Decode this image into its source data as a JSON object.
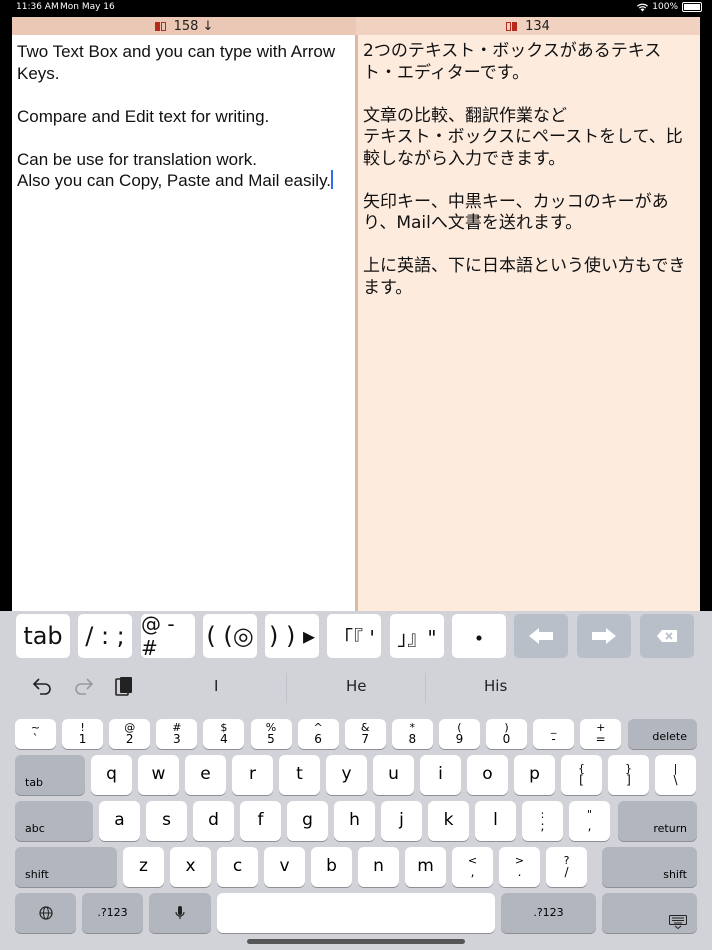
{
  "status": {
    "time": "11:36 AM",
    "date": "Mon May 16",
    "battery": "100%"
  },
  "left_pane": {
    "count": "158 ↓",
    "text": "Two Text Box and you can type with Arrow Keys.\n\nCompare and Edit text for writing.\n\nCan be use for translation work.\nAlso you can Copy, Paste and Mail easily."
  },
  "right_pane": {
    "count": "134",
    "text": "2つのテキスト・ボックスがあるテキスト・エディターです。\n\n文章の比較、翻訳作業など\nテキスト・ボックスにペーストをして、比較しながら入力できます。\n\n矢印キー、中黒キー、カッコのキーがあり、Mailへ文書を送れます。\n\n上に英語、下に日本語という使い方もできます。"
  },
  "accessory": {
    "tab": "tab",
    "slash": "/ : ;",
    "at": "@ - #",
    "open_paren": "( (◎",
    "close_paren": ") ) ▸",
    "open_bracket": "「『 '",
    "close_bracket": "」』\"",
    "dot": "・",
    "left_icon": "arrow-left-icon",
    "right_icon": "arrow-right-icon",
    "delete_icon": "delete-icon"
  },
  "suggestions": [
    "I",
    "He",
    "His"
  ],
  "keyboard": {
    "number_row": [
      [
        "~",
        "`"
      ],
      [
        "!",
        "1"
      ],
      [
        "@",
        "2"
      ],
      [
        "#",
        "3"
      ],
      [
        "$",
        "4"
      ],
      [
        "%",
        "5"
      ],
      [
        "^",
        "6"
      ],
      [
        "&",
        "7"
      ],
      [
        "*",
        "8"
      ],
      [
        "(",
        "9"
      ],
      [
        ")",
        "0"
      ],
      [
        "_",
        "-"
      ],
      [
        "+",
        "="
      ]
    ],
    "row1": [
      "q",
      "w",
      "e",
      "r",
      "t",
      "y",
      "u",
      "i",
      "o",
      "p"
    ],
    "row1_sym": [
      [
        "{",
        "["
      ],
      [
        "}",
        "]"
      ],
      [
        "|",
        "\\"
      ]
    ],
    "row2": [
      "a",
      "s",
      "d",
      "f",
      "g",
      "h",
      "j",
      "k",
      "l"
    ],
    "row2_sym": [
      [
        ":",
        ";"
      ],
      [
        "\"",
        ","
      ]
    ],
    "row3": [
      "z",
      "x",
      "c",
      "v",
      "b",
      "n",
      "m"
    ],
    "row3_sym": [
      [
        "<",
        ","
      ],
      [
        ">",
        "."
      ],
      [
        "?",
        "/"
      ]
    ],
    "delete": "delete",
    "tab": "tab",
    "abc": "abc",
    "return": "return",
    "shift": "shift",
    "numbers": ".?123"
  },
  "colors": {
    "left_header": "#ebc8b5",
    "right_header": "#f1d1c0",
    "right_pane": "#fdebde",
    "caret": "#2f6df7"
  }
}
